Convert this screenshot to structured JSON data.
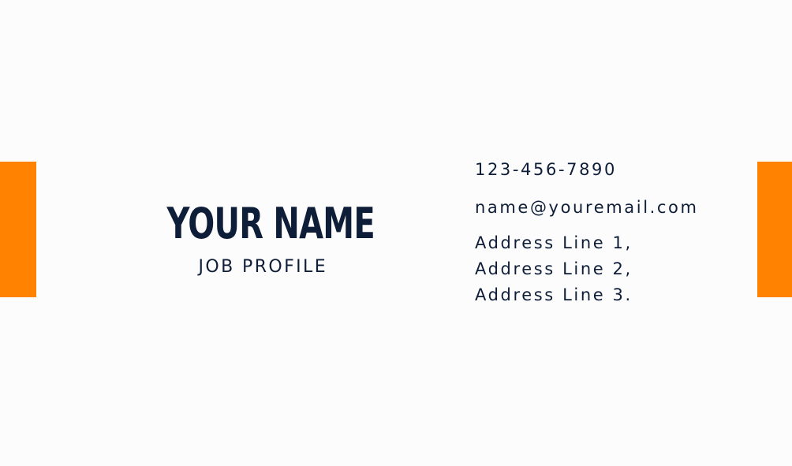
{
  "colors": {
    "accent": "#ff8300",
    "text": "#0f1e38",
    "background": "#fcfcfc"
  },
  "card": {
    "name": "YOUR NAME",
    "job_profile": "JOB PROFILE",
    "phone": "123-456-7890",
    "email": "name@youremail.com",
    "address_lines": [
      "Address Line 1,",
      "Address Line 2,",
      "Address Line 3."
    ]
  }
}
